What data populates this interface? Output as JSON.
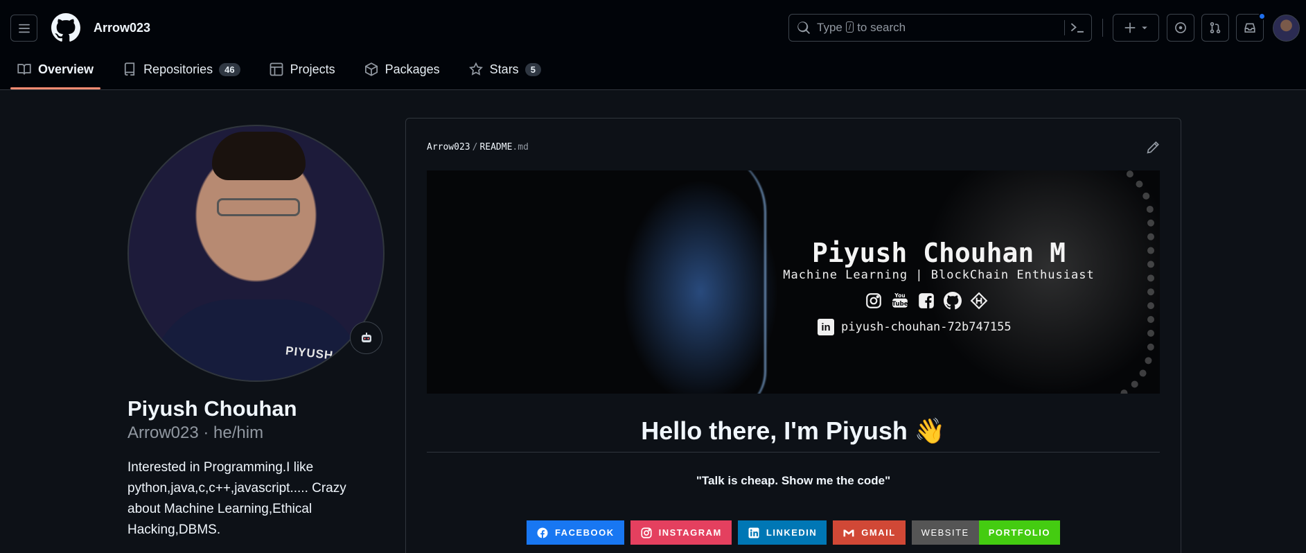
{
  "header": {
    "username": "Arrow023",
    "search": {
      "prefix": "Type",
      "key": "/",
      "suffix": "to search"
    }
  },
  "tabs": [
    {
      "label": "Overview",
      "icon": "book-icon",
      "active": true
    },
    {
      "label": "Repositories",
      "icon": "repo-icon",
      "count": "46"
    },
    {
      "label": "Projects",
      "icon": "table-icon"
    },
    {
      "label": "Packages",
      "icon": "package-icon"
    },
    {
      "label": "Stars",
      "icon": "star-icon",
      "count": "5"
    }
  ],
  "profile": {
    "name": "Piyush Chouhan",
    "login_line": "Arrow023 · he/him",
    "bio": "Interested in Programming.I like python,java,c,c++,javascript..... Crazy about Machine Learning,Ethical Hacking,DBMS.",
    "avatar_shirt_text": "PIYUSH"
  },
  "readme": {
    "owner": "Arrow023",
    "separator": "/",
    "filename": "README",
    "extension": ".md",
    "banner": {
      "name": "Piyush Chouhan M",
      "subtitle": "Machine Learning | BlockChain Enthusiast",
      "social_icons": [
        "instagram-icon",
        "youtube-icon",
        "facebook-icon",
        "github-icon",
        "hashnode-icon"
      ],
      "linkedin_icon_text": "in",
      "linkedin": "piyush-chouhan-72b747155"
    },
    "greeting": "Hello there, I'm Piyush",
    "greeting_emoji": "👋",
    "quote": "\"Talk is cheap. Show me the code\"",
    "badges": {
      "facebook": "FACEBOOK",
      "instagram": "INSTAGRAM",
      "linkedin": "LINKEDIN",
      "gmail": "GMAIL",
      "website": "WEBSITE",
      "portfolio": "PORTFOLIO"
    }
  },
  "colors": {
    "background": "#0d1117",
    "header_bg": "#010409",
    "active_tab_underline": "#fd8c73",
    "facebook": "#1877f2",
    "instagram": "#e4405f",
    "linkedin": "#0077b5",
    "gmail": "#d14836",
    "website": "#555555",
    "portfolio": "#44cc11"
  }
}
